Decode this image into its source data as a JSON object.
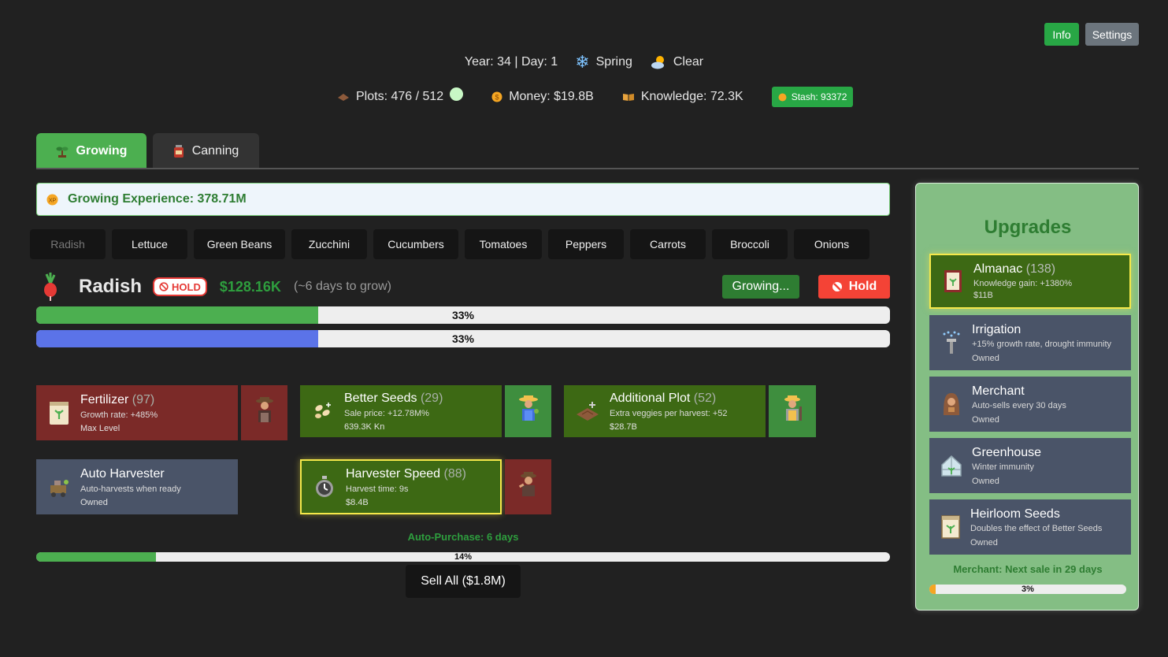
{
  "top": {
    "info_label": "Info",
    "settings_label": "Settings"
  },
  "date": {
    "year_day": "Year: 34 | Day: 1",
    "season": "Spring",
    "weather": "Clear"
  },
  "stats": {
    "plots": "Plots: 476 / 512",
    "money": "Money: $19.8B",
    "knowledge": "Knowledge: 72.3K",
    "stash": "Stash: 93372"
  },
  "tabs": [
    {
      "label": "Growing",
      "active": true
    },
    {
      "label": "Canning",
      "active": false
    }
  ],
  "experience": "Growing Experience: 378.71M",
  "crops": [
    "Radish",
    "Lettuce",
    "Green Beans",
    "Zucchini",
    "Cucumbers",
    "Tomatoes",
    "Peppers",
    "Carrots",
    "Broccoli",
    "Onions"
  ],
  "current": {
    "name": "Radish",
    "hold_badge": "HOLD",
    "price": "$128.16K",
    "grow_time": "(~6 days to grow)",
    "growing_button": "Growing...",
    "hold_button": "Hold",
    "progress1": 33,
    "progress1_label": "33%",
    "progress2": 33,
    "progress2_label": "33%"
  },
  "cards": {
    "fertilizer": {
      "name": "Fertilizer",
      "level": "(97)",
      "desc": "Growth rate: +485%",
      "sub": "Max Level"
    },
    "better_seeds": {
      "name": "Better Seeds",
      "level": "(29)",
      "desc": "Sale price: +12.78M%",
      "sub": "639.3K Kn"
    },
    "additional_plot": {
      "name": "Additional Plot",
      "level": "(52)",
      "desc": "Extra veggies per harvest: +52",
      "sub": "$28.7B"
    },
    "auto_harvester": {
      "name": "Auto Harvester",
      "desc": "Auto-harvests when ready",
      "sub": "Owned"
    },
    "harvester_speed": {
      "name": "Harvester Speed",
      "level": "(88)",
      "desc": "Harvest time: 9s",
      "sub": "$8.4B"
    }
  },
  "auto_purchase": {
    "label": "Auto-Purchase: 6 days",
    "progress": 14,
    "progress_label": "14%"
  },
  "sell_all": "Sell All ($1.8M)",
  "upgrades": {
    "title": "Upgrades",
    "items": [
      {
        "name": "Almanac",
        "level": "(138)",
        "desc": "Knowledge gain: +1380%",
        "sub": "$11B"
      },
      {
        "name": "Irrigation",
        "desc": "+15% growth rate, drought immunity",
        "sub": "Owned"
      },
      {
        "name": "Merchant",
        "desc": "Auto-sells every 30 days",
        "sub": "Owned"
      },
      {
        "name": "Greenhouse",
        "desc": "Winter immunity",
        "sub": "Owned"
      },
      {
        "name": "Heirloom Seeds",
        "desc": "Doubles the effect of Better Seeds",
        "sub": "Owned"
      }
    ],
    "merchant_next": "Merchant: Next sale in 29 days",
    "merchant_progress": 3,
    "merchant_progress_label": "3%"
  },
  "colors": {
    "green": "#4caf50",
    "dark_green_card": "#3d6914",
    "red_card": "#7b2a28",
    "slate_card": "#4a5468",
    "blue_bar": "#5b73e8",
    "hold_red": "#f44336",
    "panel_green": "#84be84"
  }
}
